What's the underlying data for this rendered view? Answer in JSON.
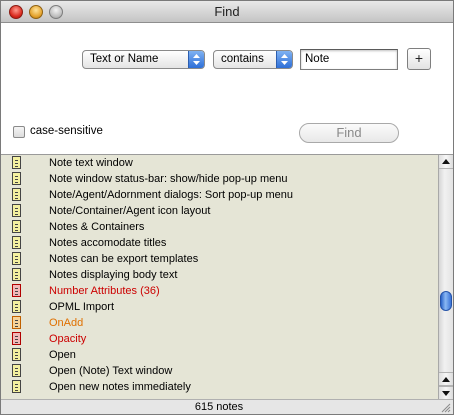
{
  "window": {
    "title": "Find"
  },
  "criteria": {
    "field_popup": "Text or Name",
    "operator_popup": "contains",
    "value": "Note",
    "add_label": "+"
  },
  "options": {
    "case_sensitive_label": "case-sensitive",
    "case_sensitive_checked": false
  },
  "find_button": {
    "label": "Find",
    "enabled": false
  },
  "results": {
    "items": [
      {
        "label": "Note text window",
        "color": "#000000",
        "icon": "note-icon"
      },
      {
        "label": "Note window status-bar: show/hide pop-up menu",
        "color": "#000000",
        "icon": "note-icon"
      },
      {
        "label": "Note/Agent/Adornment dialogs: Sort pop-up menu",
        "color": "#000000",
        "icon": "note-icon"
      },
      {
        "label": "Note/Container/Agent icon layout",
        "color": "#000000",
        "icon": "note-icon"
      },
      {
        "label": "Notes & Containers",
        "color": "#000000",
        "icon": "note-icon"
      },
      {
        "label": "Notes accomodate titles",
        "color": "#000000",
        "icon": "note-icon"
      },
      {
        "label": "Notes can be export templates",
        "color": "#000000",
        "icon": "note-icon"
      },
      {
        "label": "Notes displaying body text",
        "color": "#000000",
        "icon": "note-icon"
      },
      {
        "label": "Number Attributes (36)",
        "color": "#cc0000",
        "icon": "note-icon-red"
      },
      {
        "label": "OPML Import",
        "color": "#000000",
        "icon": "note-icon"
      },
      {
        "label": "OnAdd",
        "color": "#e07000",
        "icon": "note-icon-orange"
      },
      {
        "label": "Opacity",
        "color": "#cc0000",
        "icon": "note-icon-red"
      },
      {
        "label": "Open",
        "color": "#000000",
        "icon": "note-icon"
      },
      {
        "label": "Open (Note) Text window",
        "color": "#000000",
        "icon": "note-icon"
      },
      {
        "label": "Open new notes immediately",
        "color": "#000000",
        "icon": "note-icon"
      }
    ],
    "scroll_position": 0.5
  },
  "status": {
    "count": "615 notes"
  },
  "colors": {
    "list_background": "#e5e5d6",
    "accent_blue": "#2e6fd8"
  }
}
